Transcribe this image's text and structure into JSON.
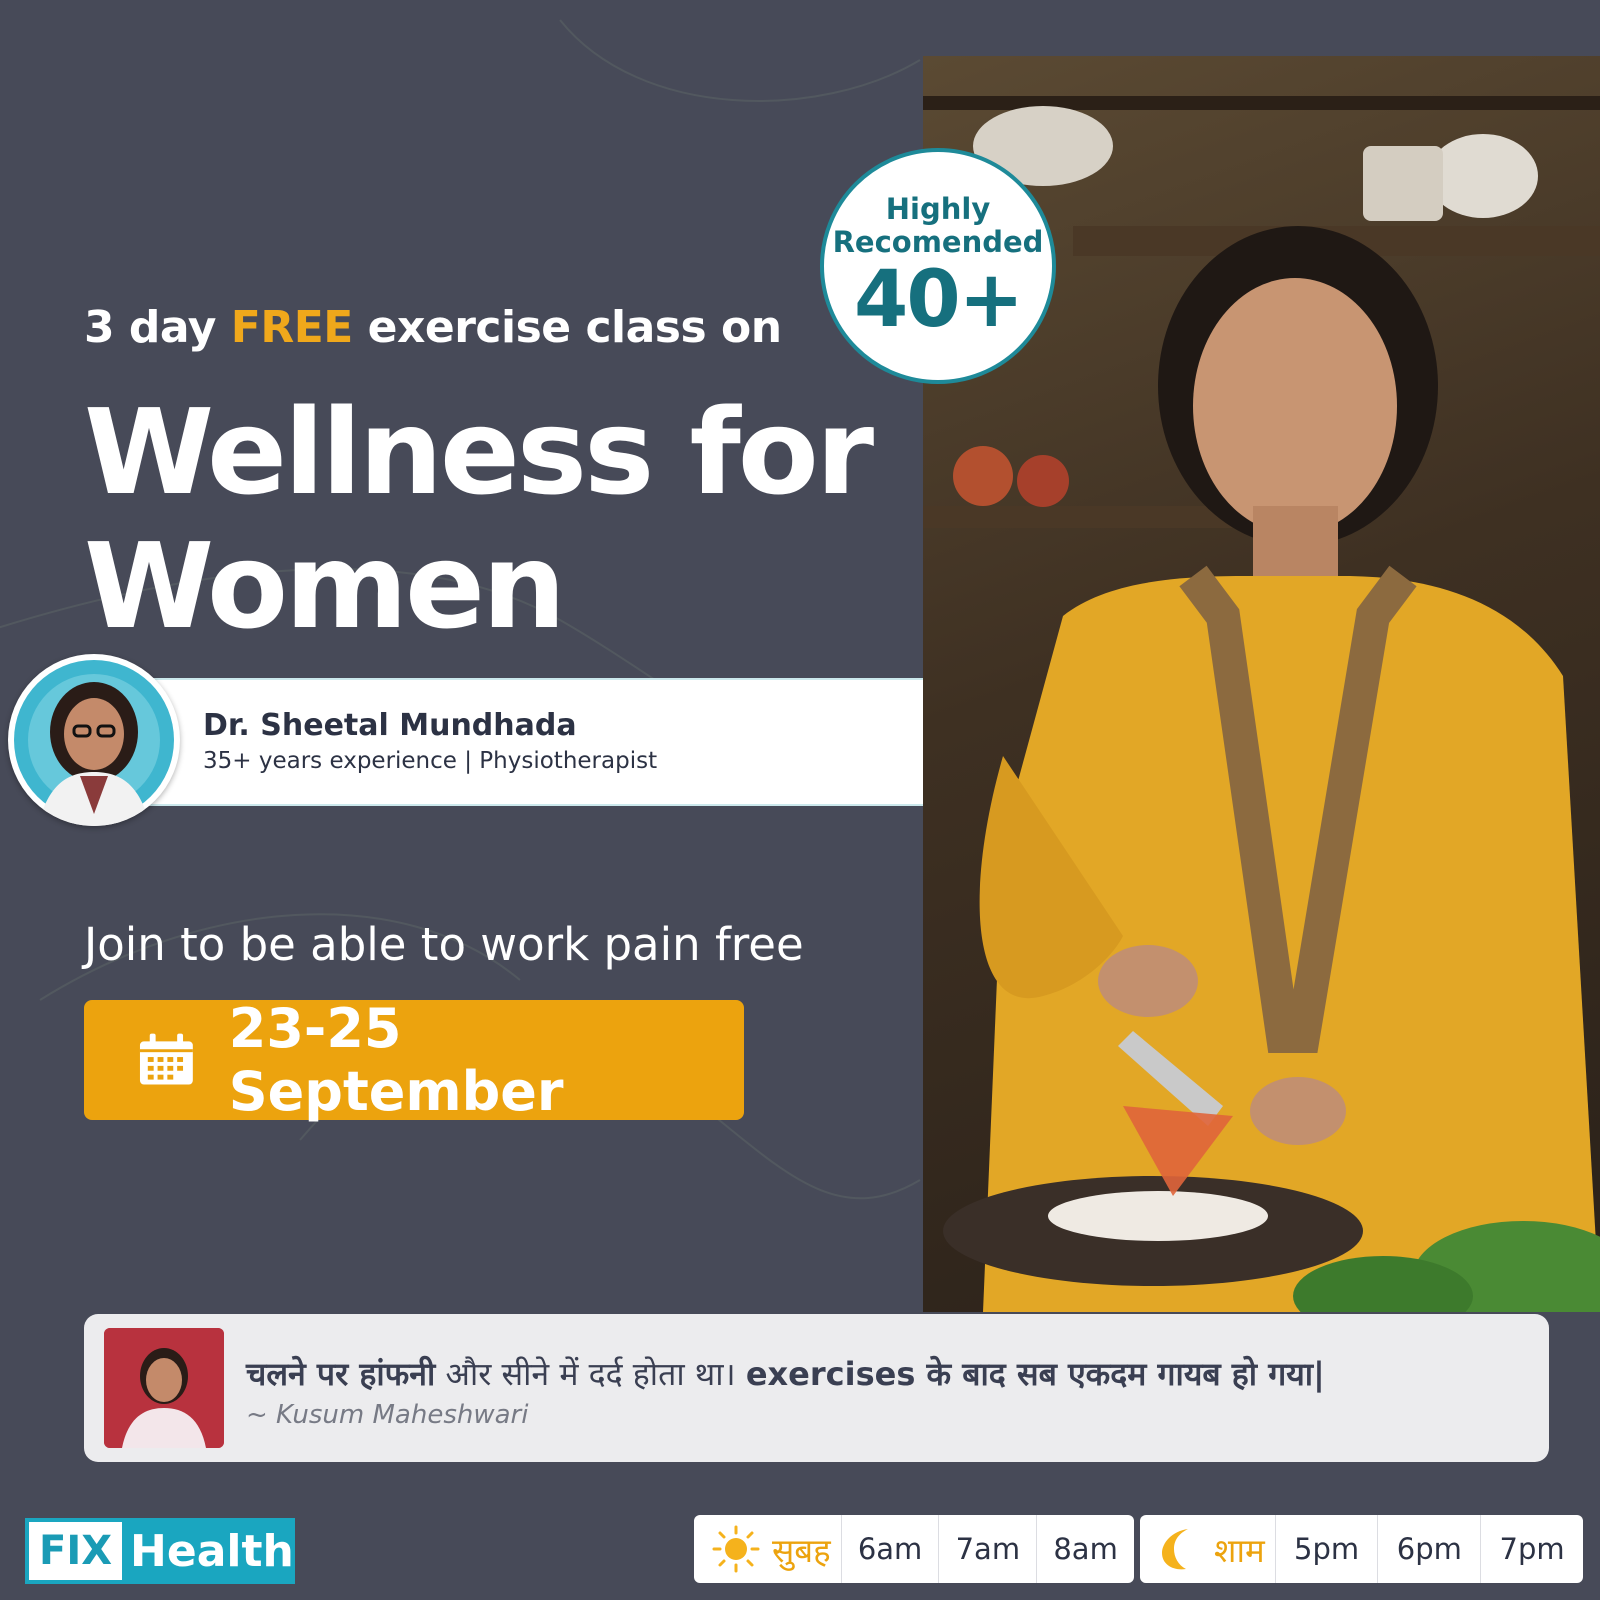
{
  "colors": {
    "background": "#474a58",
    "accent": "#eca30e",
    "teal": "#1e8a99",
    "white": "#ffffff"
  },
  "badge": {
    "line1": "Highly",
    "line2": "Recomended",
    "value": "40+"
  },
  "headline": {
    "prefix": "3 day ",
    "highlight": "FREE",
    "suffix": " exercise class on",
    "title_line1": "Wellness for",
    "title_line2": "Women"
  },
  "doctor": {
    "name": "Dr. Sheetal Mundhada",
    "meta": "35+ years experience | Physiotherapist"
  },
  "tagline": "Join to be able to work pain free",
  "date": {
    "icon": "calendar-icon",
    "label": "23-25 September"
  },
  "testimonial": {
    "quote_bold1": "चलने पर हांफनी",
    "quote_regular": " और सीने में दर्द होता था। ",
    "quote_bold2": "exercises के बाद सब एकदम गायब हो गया|",
    "author": "~ Kusum Maheshwari"
  },
  "logo": {
    "part1": "FIX",
    "part2": "Health"
  },
  "schedule": {
    "morning": {
      "icon": "sun-icon",
      "label": "सुबह",
      "times": [
        "6am",
        "7am",
        "8am"
      ]
    },
    "evening": {
      "icon": "moon-icon",
      "label": "शाम",
      "times": [
        "5pm",
        "6pm",
        "7pm"
      ]
    }
  }
}
